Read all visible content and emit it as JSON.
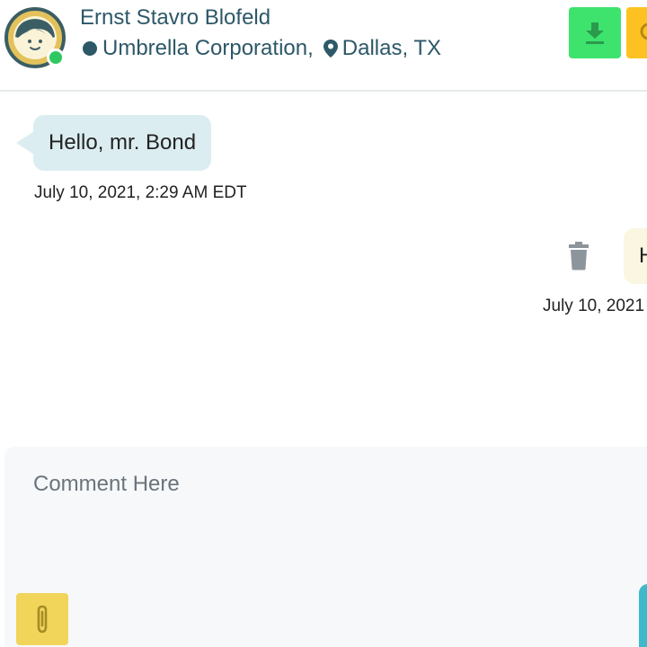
{
  "header": {
    "contact_name": "Ernst Stavro Blofeld",
    "company": "Umbrella Corporation,",
    "location": "Dallas, TX",
    "avatar_icon": "person-avatar-icon",
    "online": true,
    "actions": [
      {
        "name": "download-button",
        "icon": "download-icon",
        "color": "#3ee36e"
      },
      {
        "name": "search-button",
        "icon": "search-icon",
        "color": "#fdc221"
      }
    ]
  },
  "messages": [
    {
      "direction": "incoming",
      "text": "Hello, mr. Bond",
      "timestamp": "July 10, 2021, 2:29 AM EDT"
    },
    {
      "direction": "outgoing",
      "text": "H",
      "timestamp": "July 10, 2021"
    }
  ],
  "composer": {
    "placeholder": "Comment Here",
    "value": "",
    "attach_icon": "paperclip-icon",
    "attach_color": "#f0d55a",
    "send_color": "#3fb9c9"
  },
  "colors": {
    "primary_text": "#2d5868",
    "incoming_bubble": "#dcedf1",
    "outgoing_bubble": "#fbf6e1",
    "online": "#2fc860"
  }
}
